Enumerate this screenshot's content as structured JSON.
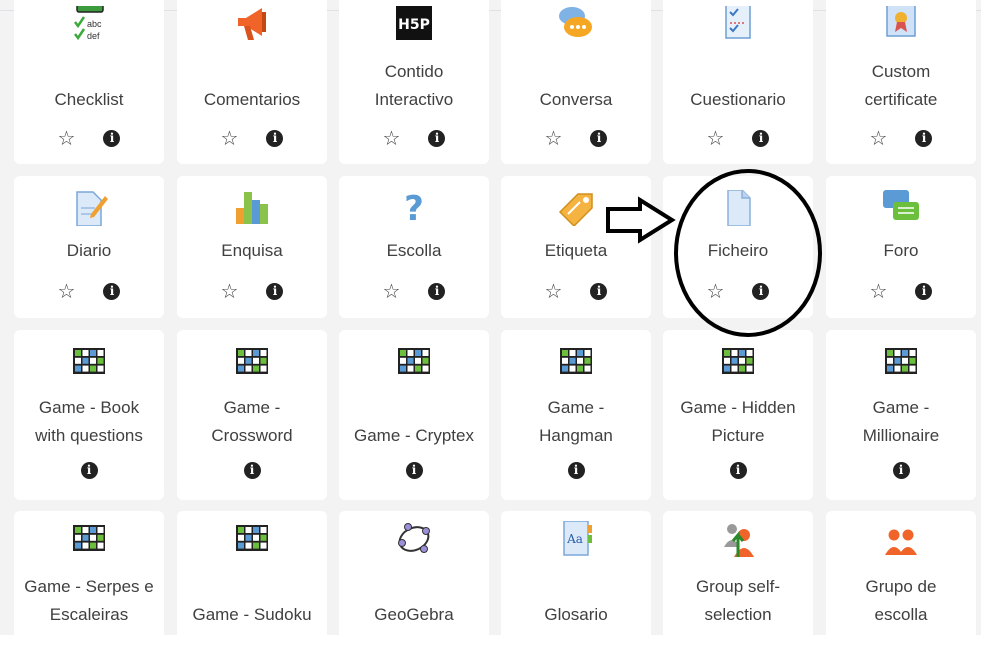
{
  "activities": [
    {
      "label_lines": [
        "Checklist"
      ],
      "icon": "checklist-icon",
      "star": true
    },
    {
      "label_lines": [
        "Comentarios"
      ],
      "icon": "megaphone-icon",
      "star": true
    },
    {
      "label_lines": [
        "Contido",
        "Interactivo"
      ],
      "icon": "h5p-icon",
      "icon_text": "H5P",
      "star": true
    },
    {
      "label_lines": [
        "Conversa"
      ],
      "icon": "chat-bubble-icon",
      "star": true
    },
    {
      "label_lines": [
        "Cuestionario"
      ],
      "icon": "quiz-checklist-icon",
      "star": true
    },
    {
      "label_lines": [
        "Custom",
        "certificate"
      ],
      "icon": "certificate-icon",
      "star": true
    },
    {
      "label_lines": [
        "Diario"
      ],
      "icon": "journal-icon",
      "star": true
    },
    {
      "label_lines": [
        "Enquisa"
      ],
      "icon": "bar-chart-icon",
      "star": true
    },
    {
      "label_lines": [
        "Escolla"
      ],
      "icon": "question-mark-icon",
      "star": true
    },
    {
      "label_lines": [
        "Etiqueta"
      ],
      "icon": "tag-icon",
      "star": true
    },
    {
      "label_lines": [
        "Ficheiro"
      ],
      "icon": "file-icon",
      "star": true
    },
    {
      "label_lines": [
        "Foro"
      ],
      "icon": "forum-icon",
      "star": true
    },
    {
      "label_lines": [
        "Game - Book",
        "with questions"
      ],
      "icon": "game-board-icon",
      "star": false
    },
    {
      "label_lines": [
        "Game -",
        "Crossword"
      ],
      "icon": "game-board-icon",
      "star": false
    },
    {
      "label_lines": [
        "Game - Cryptex"
      ],
      "icon": "game-board-icon",
      "star": false
    },
    {
      "label_lines": [
        "Game -",
        "Hangman"
      ],
      "icon": "game-board-icon",
      "star": false
    },
    {
      "label_lines": [
        "Game - Hidden",
        "Picture"
      ],
      "icon": "game-board-icon",
      "star": false
    },
    {
      "label_lines": [
        "Game -",
        "Millionaire"
      ],
      "icon": "game-board-icon",
      "star": false
    },
    {
      "label_lines": [
        "Game - Serpes e",
        "Escaleiras"
      ],
      "icon": "game-board-icon",
      "star": false
    },
    {
      "label_lines": [
        "Game - Sudoku"
      ],
      "icon": "game-board-icon",
      "star": false
    },
    {
      "label_lines": [
        "GeoGebra"
      ],
      "icon": "geogebra-icon",
      "star": false
    },
    {
      "label_lines": [
        "Glosario"
      ],
      "icon": "glossary-icon",
      "star": false
    },
    {
      "label_lines": [
        "Group self-",
        "selection"
      ],
      "icon": "group-selection-icon",
      "star": false
    },
    {
      "label_lines": [
        "Grupo de",
        "escolla"
      ],
      "icon": "group-choice-icon",
      "star": false
    }
  ],
  "glyphs": {
    "star": "☆",
    "info": "i"
  },
  "annotation": {
    "highlighted": "Ficheiro",
    "arrow": "right-arrow-icon",
    "ellipse": "highlight-ellipse"
  }
}
